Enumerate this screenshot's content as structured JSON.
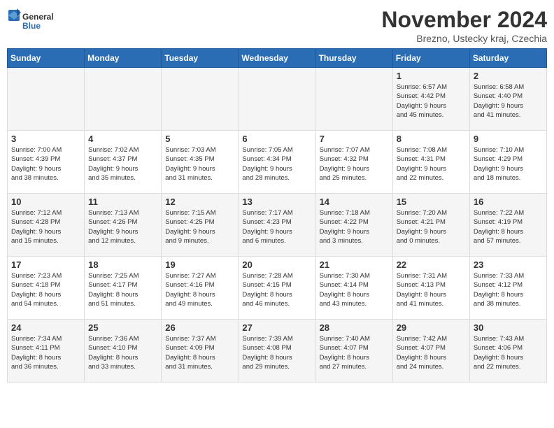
{
  "logo": {
    "text_general": "General",
    "text_blue": "Blue"
  },
  "title": "November 2024",
  "location": "Brezno, Ustecky kraj, Czechia",
  "weekdays": [
    "Sunday",
    "Monday",
    "Tuesday",
    "Wednesday",
    "Thursday",
    "Friday",
    "Saturday"
  ],
  "weeks": [
    [
      {
        "day": "",
        "info": ""
      },
      {
        "day": "",
        "info": ""
      },
      {
        "day": "",
        "info": ""
      },
      {
        "day": "",
        "info": ""
      },
      {
        "day": "",
        "info": ""
      },
      {
        "day": "1",
        "info": "Sunrise: 6:57 AM\nSunset: 4:42 PM\nDaylight: 9 hours\nand 45 minutes."
      },
      {
        "day": "2",
        "info": "Sunrise: 6:58 AM\nSunset: 4:40 PM\nDaylight: 9 hours\nand 41 minutes."
      }
    ],
    [
      {
        "day": "3",
        "info": "Sunrise: 7:00 AM\nSunset: 4:39 PM\nDaylight: 9 hours\nand 38 minutes."
      },
      {
        "day": "4",
        "info": "Sunrise: 7:02 AM\nSunset: 4:37 PM\nDaylight: 9 hours\nand 35 minutes."
      },
      {
        "day": "5",
        "info": "Sunrise: 7:03 AM\nSunset: 4:35 PM\nDaylight: 9 hours\nand 31 minutes."
      },
      {
        "day": "6",
        "info": "Sunrise: 7:05 AM\nSunset: 4:34 PM\nDaylight: 9 hours\nand 28 minutes."
      },
      {
        "day": "7",
        "info": "Sunrise: 7:07 AM\nSunset: 4:32 PM\nDaylight: 9 hours\nand 25 minutes."
      },
      {
        "day": "8",
        "info": "Sunrise: 7:08 AM\nSunset: 4:31 PM\nDaylight: 9 hours\nand 22 minutes."
      },
      {
        "day": "9",
        "info": "Sunrise: 7:10 AM\nSunset: 4:29 PM\nDaylight: 9 hours\nand 18 minutes."
      }
    ],
    [
      {
        "day": "10",
        "info": "Sunrise: 7:12 AM\nSunset: 4:28 PM\nDaylight: 9 hours\nand 15 minutes."
      },
      {
        "day": "11",
        "info": "Sunrise: 7:13 AM\nSunset: 4:26 PM\nDaylight: 9 hours\nand 12 minutes."
      },
      {
        "day": "12",
        "info": "Sunrise: 7:15 AM\nSunset: 4:25 PM\nDaylight: 9 hours\nand 9 minutes."
      },
      {
        "day": "13",
        "info": "Sunrise: 7:17 AM\nSunset: 4:23 PM\nDaylight: 9 hours\nand 6 minutes."
      },
      {
        "day": "14",
        "info": "Sunrise: 7:18 AM\nSunset: 4:22 PM\nDaylight: 9 hours\nand 3 minutes."
      },
      {
        "day": "15",
        "info": "Sunrise: 7:20 AM\nSunset: 4:21 PM\nDaylight: 9 hours\nand 0 minutes."
      },
      {
        "day": "16",
        "info": "Sunrise: 7:22 AM\nSunset: 4:19 PM\nDaylight: 8 hours\nand 57 minutes."
      }
    ],
    [
      {
        "day": "17",
        "info": "Sunrise: 7:23 AM\nSunset: 4:18 PM\nDaylight: 8 hours\nand 54 minutes."
      },
      {
        "day": "18",
        "info": "Sunrise: 7:25 AM\nSunset: 4:17 PM\nDaylight: 8 hours\nand 51 minutes."
      },
      {
        "day": "19",
        "info": "Sunrise: 7:27 AM\nSunset: 4:16 PM\nDaylight: 8 hours\nand 49 minutes."
      },
      {
        "day": "20",
        "info": "Sunrise: 7:28 AM\nSunset: 4:15 PM\nDaylight: 8 hours\nand 46 minutes."
      },
      {
        "day": "21",
        "info": "Sunrise: 7:30 AM\nSunset: 4:14 PM\nDaylight: 8 hours\nand 43 minutes."
      },
      {
        "day": "22",
        "info": "Sunrise: 7:31 AM\nSunset: 4:13 PM\nDaylight: 8 hours\nand 41 minutes."
      },
      {
        "day": "23",
        "info": "Sunrise: 7:33 AM\nSunset: 4:12 PM\nDaylight: 8 hours\nand 38 minutes."
      }
    ],
    [
      {
        "day": "24",
        "info": "Sunrise: 7:34 AM\nSunset: 4:11 PM\nDaylight: 8 hours\nand 36 minutes."
      },
      {
        "day": "25",
        "info": "Sunrise: 7:36 AM\nSunset: 4:10 PM\nDaylight: 8 hours\nand 33 minutes."
      },
      {
        "day": "26",
        "info": "Sunrise: 7:37 AM\nSunset: 4:09 PM\nDaylight: 8 hours\nand 31 minutes."
      },
      {
        "day": "27",
        "info": "Sunrise: 7:39 AM\nSunset: 4:08 PM\nDaylight: 8 hours\nand 29 minutes."
      },
      {
        "day": "28",
        "info": "Sunrise: 7:40 AM\nSunset: 4:07 PM\nDaylight: 8 hours\nand 27 minutes."
      },
      {
        "day": "29",
        "info": "Sunrise: 7:42 AM\nSunset: 4:07 PM\nDaylight: 8 hours\nand 24 minutes."
      },
      {
        "day": "30",
        "info": "Sunrise: 7:43 AM\nSunset: 4:06 PM\nDaylight: 8 hours\nand 22 minutes."
      }
    ]
  ]
}
